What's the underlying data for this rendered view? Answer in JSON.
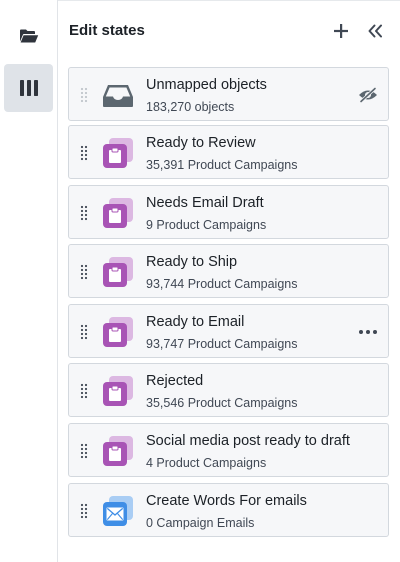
{
  "rail": {
    "items": [
      {
        "icon": "folder-open-icon",
        "active": false
      },
      {
        "icon": "columns-icon",
        "active": true
      }
    ]
  },
  "panel": {
    "title": "Edit states",
    "add_icon": "plus-icon",
    "collapse_icon": "double-chevron-left-icon"
  },
  "colors": {
    "accent_purple": "#a854b5",
    "accent_purple_light": "#dcb8e2",
    "accent_blue": "#3f8ee6",
    "inbox_dark": "#5c6770",
    "text_muted": "#404854"
  },
  "states": [
    {
      "name": "Unmapped objects",
      "count": "183,270 objects",
      "icon": "inbox-icon",
      "action": "eye-off-icon"
    },
    {
      "name": "Ready to Review",
      "count": "35,391 Product Campaigns",
      "icon": "clipboard-icon",
      "action": ""
    },
    {
      "name": "Needs Email Draft",
      "count": "9 Product Campaigns",
      "icon": "clipboard-icon",
      "action": ""
    },
    {
      "name": "Ready to Ship",
      "count": "93,744 Product Campaigns",
      "icon": "clipboard-icon",
      "action": ""
    },
    {
      "name": "Ready to Email",
      "count": "93,747 Product Campaigns",
      "icon": "clipboard-icon",
      "action": "more-icon"
    },
    {
      "name": "Rejected",
      "count": "35,546 Product Campaigns",
      "icon": "clipboard-icon",
      "action": ""
    },
    {
      "name": "Social media post ready to draft",
      "count": "4 Product Campaigns",
      "icon": "clipboard-icon",
      "action": ""
    },
    {
      "name": "Create Words For emails",
      "count": "0 Campaign Emails",
      "icon": "envelope-icon",
      "action": ""
    }
  ]
}
